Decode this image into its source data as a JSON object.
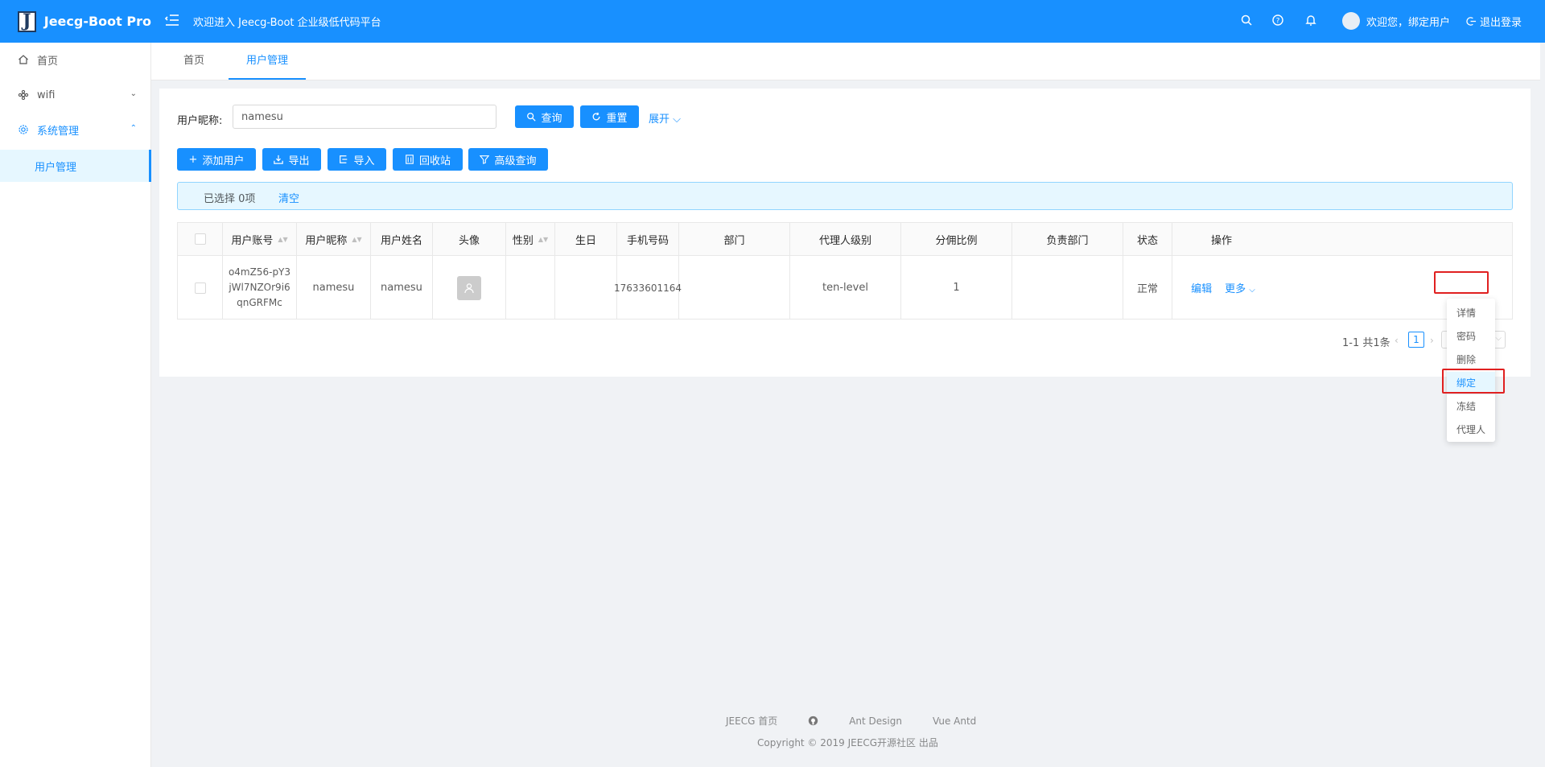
{
  "header": {
    "logo_letter": "J",
    "app_name": "Jeecg-Boot Pro",
    "welcome": "欢迎进入 Jeecg-Boot 企业级低代码平台",
    "user_greeting": "欢迎您，绑定用户",
    "logout": "退出登录",
    "bg_color": "#1890ff"
  },
  "sidebar": {
    "items": [
      {
        "label": "首页",
        "icon": "home-icon"
      },
      {
        "label": "wifi",
        "icon": "wifi-icon",
        "arrow": "chevron-down-icon"
      },
      {
        "label": "系统管理",
        "icon": "gear-icon",
        "arrow": "chevron-up-icon"
      }
    ],
    "sub_item": "用户管理"
  },
  "tabs": [
    {
      "label": "首页",
      "active": false
    },
    {
      "label": "用户管理",
      "active": true
    }
  ],
  "search": {
    "label": "用户昵称:",
    "value": "namesu",
    "query_button": "查询",
    "reset_button": "重置",
    "expand": "展开"
  },
  "toolbar": {
    "add": "添加用户",
    "export": "导出",
    "import": "导入",
    "recycle": "回收站",
    "advanced": "高级查询"
  },
  "alert": {
    "selected": "已选择 0项",
    "clear": "清空"
  },
  "table": {
    "columns": [
      "用户账号",
      "用户昵称",
      "用户姓名",
      "头像",
      "性别",
      "生日",
      "手机号码",
      "部门",
      "代理人级别",
      "分佣比例",
      "负责部门",
      "状态",
      "操作"
    ],
    "rows": [
      {
        "account": "o4mZ56-pY3jWl7NZOr9i6qnGRFMc",
        "nickname": "namesu",
        "realname": "namesu",
        "gender": "",
        "birthday": "",
        "phone": "17633601164",
        "department": "",
        "agent_level": "ten-level",
        "commission": "1",
        "responsible_dept": "",
        "status": "正常",
        "edit": "编辑",
        "more": "更多"
      }
    ]
  },
  "pagination": {
    "total": "1-1 共1条",
    "current": "1"
  },
  "dropdown": {
    "items": [
      "详情",
      "密码",
      "删除",
      "绑定",
      "冻结",
      "代理人"
    ],
    "highlighted": "绑定"
  },
  "footer": {
    "links": [
      "JEECG 首页",
      "Ant Design",
      "Vue Antd"
    ],
    "copyright": "Copyright © 2019 JEECG开源社区 出品"
  }
}
